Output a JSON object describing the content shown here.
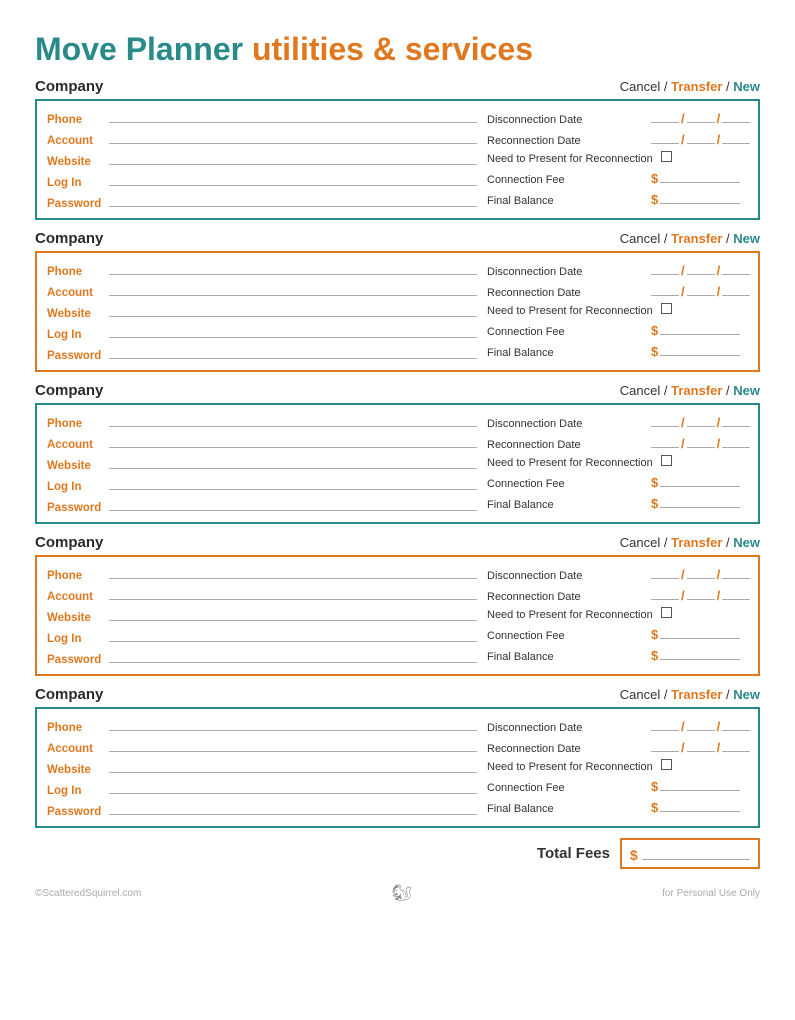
{
  "title": {
    "part1": "Move Planner",
    "part2": " utilities & services"
  },
  "sections": [
    {
      "id": 1,
      "border": "teal",
      "header": {
        "company_label": "Company",
        "cancel": "Cancel",
        "slash1": " / ",
        "transfer": "Transfer",
        "slash2": " / ",
        "new": "New"
      },
      "left_fields": [
        {
          "label": "Phone",
          "value": ""
        },
        {
          "label": "Account",
          "value": ""
        },
        {
          "label": "Website",
          "value": ""
        },
        {
          "label": "Log In",
          "value": ""
        },
        {
          "label": "Password",
          "value": ""
        }
      ],
      "right_fields": [
        {
          "type": "date",
          "label": "Disconnection Date"
        },
        {
          "type": "date",
          "label": "Reconnection Date"
        },
        {
          "type": "checkbox",
          "label": "Need to Present for Reconnection"
        },
        {
          "type": "dollar",
          "label": "Connection Fee"
        },
        {
          "type": "dollar_plain",
          "label": "Final Balance"
        }
      ]
    },
    {
      "id": 2,
      "border": "orange",
      "header": {
        "company_label": "Company",
        "cancel": "Cancel",
        "slash1": " / ",
        "transfer": "Transfer",
        "slash2": " / ",
        "new": "New"
      },
      "left_fields": [
        {
          "label": "Phone",
          "value": ""
        },
        {
          "label": "Account",
          "value": ""
        },
        {
          "label": "Website",
          "value": ""
        },
        {
          "label": "Log In",
          "value": ""
        },
        {
          "label": "Password",
          "value": ""
        }
      ],
      "right_fields": [
        {
          "type": "date",
          "label": "Disconnection Date"
        },
        {
          "type": "date",
          "label": "Reconnection Date"
        },
        {
          "type": "checkbox",
          "label": "Need to Present for Reconnection"
        },
        {
          "type": "dollar",
          "label": "Connection Fee"
        },
        {
          "type": "dollar_plain",
          "label": "Final Balance"
        }
      ]
    },
    {
      "id": 3,
      "border": "teal",
      "header": {
        "company_label": "Company",
        "cancel": "Cancel",
        "slash1": " / ",
        "transfer": "Transfer",
        "slash2": " / ",
        "new": "New"
      },
      "left_fields": [
        {
          "label": "Phone",
          "value": ""
        },
        {
          "label": "Account",
          "value": ""
        },
        {
          "label": "Website",
          "value": ""
        },
        {
          "label": "Log In",
          "value": ""
        },
        {
          "label": "Password",
          "value": ""
        }
      ],
      "right_fields": [
        {
          "type": "date",
          "label": "Disconnection Date"
        },
        {
          "type": "date",
          "label": "Reconnection Date"
        },
        {
          "type": "checkbox",
          "label": "Need to Present for Reconnection"
        },
        {
          "type": "dollar",
          "label": "Connection Fee"
        },
        {
          "type": "dollar_plain",
          "label": "Final Balance"
        }
      ]
    },
    {
      "id": 4,
      "border": "orange",
      "header": {
        "company_label": "Company",
        "cancel": "Cancel",
        "slash1": " / ",
        "transfer": "Transfer",
        "slash2": " / ",
        "new": "New"
      },
      "left_fields": [
        {
          "label": "Phone",
          "value": ""
        },
        {
          "label": "Account",
          "value": ""
        },
        {
          "label": "Website",
          "value": ""
        },
        {
          "label": "Log In",
          "value": ""
        },
        {
          "label": "Password",
          "value": ""
        }
      ],
      "right_fields": [
        {
          "type": "date",
          "label": "Disconnection Date"
        },
        {
          "type": "date",
          "label": "Reconnection Date"
        },
        {
          "type": "checkbox",
          "label": "Need to Present for Reconnection"
        },
        {
          "type": "dollar",
          "label": "Connection Fee"
        },
        {
          "type": "dollar_plain",
          "label": "Final Balance"
        }
      ]
    },
    {
      "id": 5,
      "border": "teal",
      "header": {
        "company_label": "Company",
        "cancel": "Cancel",
        "slash1": " / ",
        "transfer": "Transfer",
        "slash2": " / ",
        "new": "New"
      },
      "left_fields": [
        {
          "label": "Phone",
          "value": ""
        },
        {
          "label": "Account",
          "value": ""
        },
        {
          "label": "Website",
          "value": ""
        },
        {
          "label": "Log In",
          "value": ""
        },
        {
          "label": "Password",
          "value": ""
        }
      ],
      "right_fields": [
        {
          "type": "date",
          "label": "Disconnection Date"
        },
        {
          "type": "date",
          "label": "Reconnection Date"
        },
        {
          "type": "checkbox",
          "label": "Need to Present for Reconnection"
        },
        {
          "type": "dollar",
          "label": "Connection Fee"
        },
        {
          "type": "dollar_plain",
          "label": "Final Balance"
        }
      ]
    }
  ],
  "total_fees": {
    "label": "Total Fees",
    "dollar_sign": "$"
  },
  "footer": {
    "left": "©ScatteredSquirrel.com",
    "right": "for Personal Use Only"
  }
}
